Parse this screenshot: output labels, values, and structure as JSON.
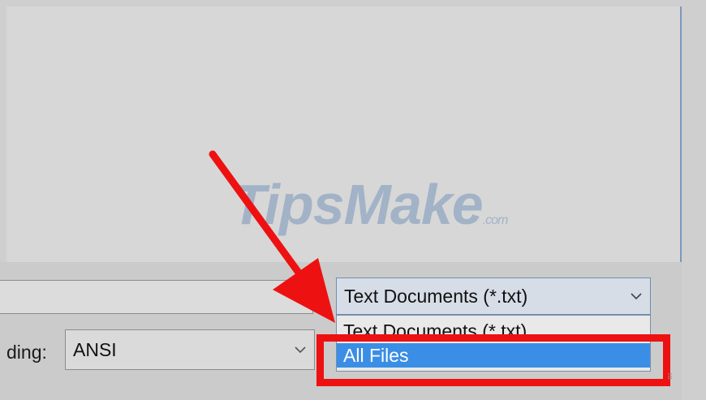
{
  "dialog": {
    "encoding_label": "ding:",
    "encoding_value": "ANSI",
    "file_type_value": "Text Documents (*.txt)",
    "file_type_options": [
      "Text Documents (*.txt)",
      "All Files"
    ],
    "selected_option_index": 1
  },
  "watermark": {
    "brand": "TipsMake",
    "suffix": ".com"
  },
  "icons": {
    "dropdown": "chevron-down-icon",
    "arrow": "red-arrow-annotation",
    "grip": "resize-grip-icon"
  },
  "colors": {
    "highlight": "#3b8ee6",
    "annotation": "#ee1111",
    "select_border": "#6f8fb2"
  }
}
